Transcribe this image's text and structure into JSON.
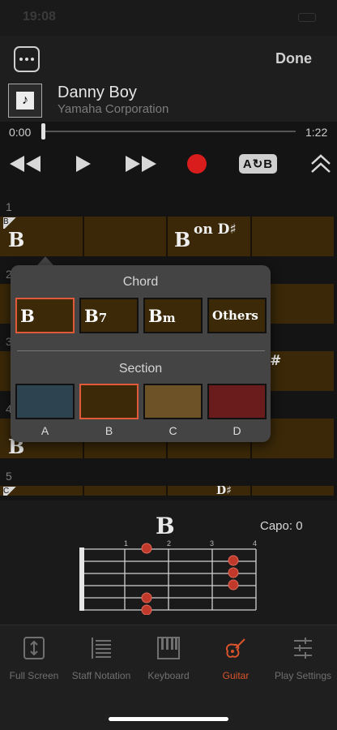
{
  "status": {
    "time": "19:08"
  },
  "header": {
    "done_label": "Done",
    "more_icon": "ellipsis-icon"
  },
  "song": {
    "title": "Danny Boy",
    "artist": "Yamaha Corporation"
  },
  "progress": {
    "current": "0:00",
    "total": "1:22",
    "fraction": 0.0
  },
  "transport": {
    "ab_label": "A↻B"
  },
  "measures": [
    {
      "number": "1",
      "section": "B",
      "chords": [
        "B",
        "",
        "on D♯",
        ""
      ],
      "chord_roots": [
        "B",
        "",
        "B",
        ""
      ]
    },
    {
      "number": "2"
    },
    {
      "number": "3",
      "chord_frag": "#"
    },
    {
      "number": "4",
      "chord_frag": "B"
    },
    {
      "number": "5",
      "section": "C",
      "chord_frag": "D♯"
    }
  ],
  "popup": {
    "chord_header": "Chord",
    "chord_options": [
      {
        "label": "B",
        "selected": true
      },
      {
        "label": "B7",
        "selected": false
      },
      {
        "label": "Bm",
        "selected": false
      },
      {
        "label": "Others",
        "selected": false
      }
    ],
    "section_header": "Section",
    "sections": [
      {
        "label": "A",
        "color": "#2d4350",
        "selected": false
      },
      {
        "label": "B",
        "color": "#3c2908",
        "selected": true
      },
      {
        "label": "C",
        "color": "#6e5227",
        "selected": false
      },
      {
        "label": "D",
        "color": "#6a1c1c",
        "selected": false
      }
    ]
  },
  "guitar": {
    "chord": "B",
    "capo": "Capo: 0",
    "fret_numbers": [
      "1",
      "2",
      "3",
      "4"
    ]
  },
  "tabs": [
    {
      "label": "Full Screen",
      "icon": "fullscreen-icon"
    },
    {
      "label": "Staff Notation",
      "icon": "staff-notation-icon"
    },
    {
      "label": "Keyboard",
      "icon": "keyboard-icon"
    },
    {
      "label": "Guitar",
      "icon": "guitar-icon",
      "active": true
    },
    {
      "label": "Play Settings",
      "icon": "sliders-icon"
    }
  ],
  "colors": {
    "accent": "#d9532c",
    "record": "#d91c1c",
    "measure_bg": "#3a2808"
  }
}
